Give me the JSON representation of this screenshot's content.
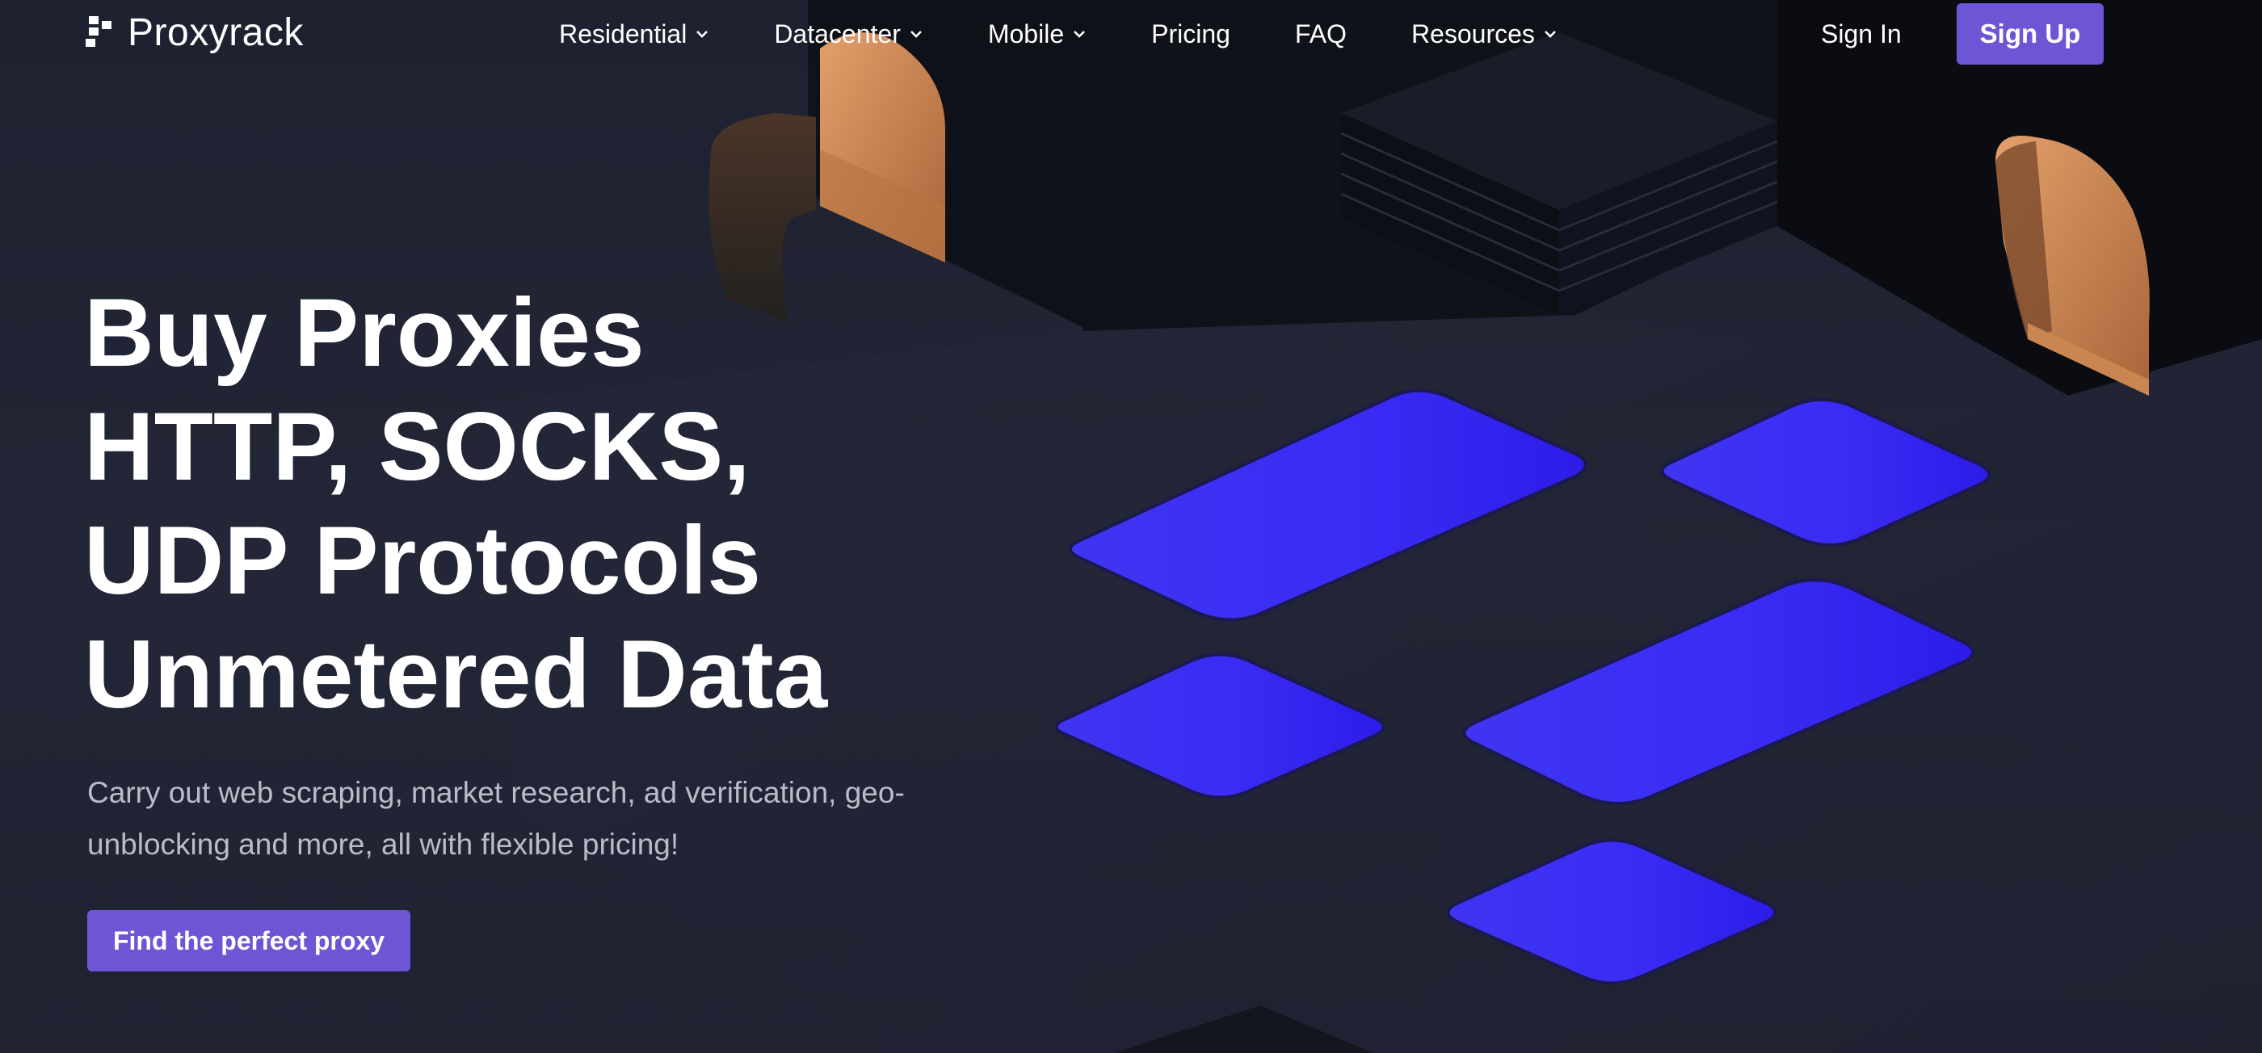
{
  "brand": {
    "name": "Proxyrack"
  },
  "nav": {
    "items": [
      {
        "label": "Residential",
        "has_dropdown": true
      },
      {
        "label": "Datacenter",
        "has_dropdown": true
      },
      {
        "label": "Mobile",
        "has_dropdown": true
      },
      {
        "label": "Pricing",
        "has_dropdown": false
      },
      {
        "label": "FAQ",
        "has_dropdown": false
      },
      {
        "label": "Resources",
        "has_dropdown": true
      }
    ],
    "sign_in": "Sign In",
    "sign_up": "Sign Up"
  },
  "hero": {
    "title_lines": [
      "Buy Proxies",
      "HTTP, SOCKS,",
      "UDP Protocols",
      "Unmetered Data"
    ],
    "subtitle": "Carry out web scraping, market research, ad verification, geo-unblocking and more, all with flexible pricing!",
    "cta_label": "Find the perfect proxy"
  },
  "colors": {
    "background": "#1f2230",
    "accent": "#6e55d6",
    "panel_blue": "#3423f0",
    "copper": "#c98651"
  },
  "icons": {
    "logo": "proxyrack-logo-icon",
    "dropdown": "chevron-down-icon"
  }
}
